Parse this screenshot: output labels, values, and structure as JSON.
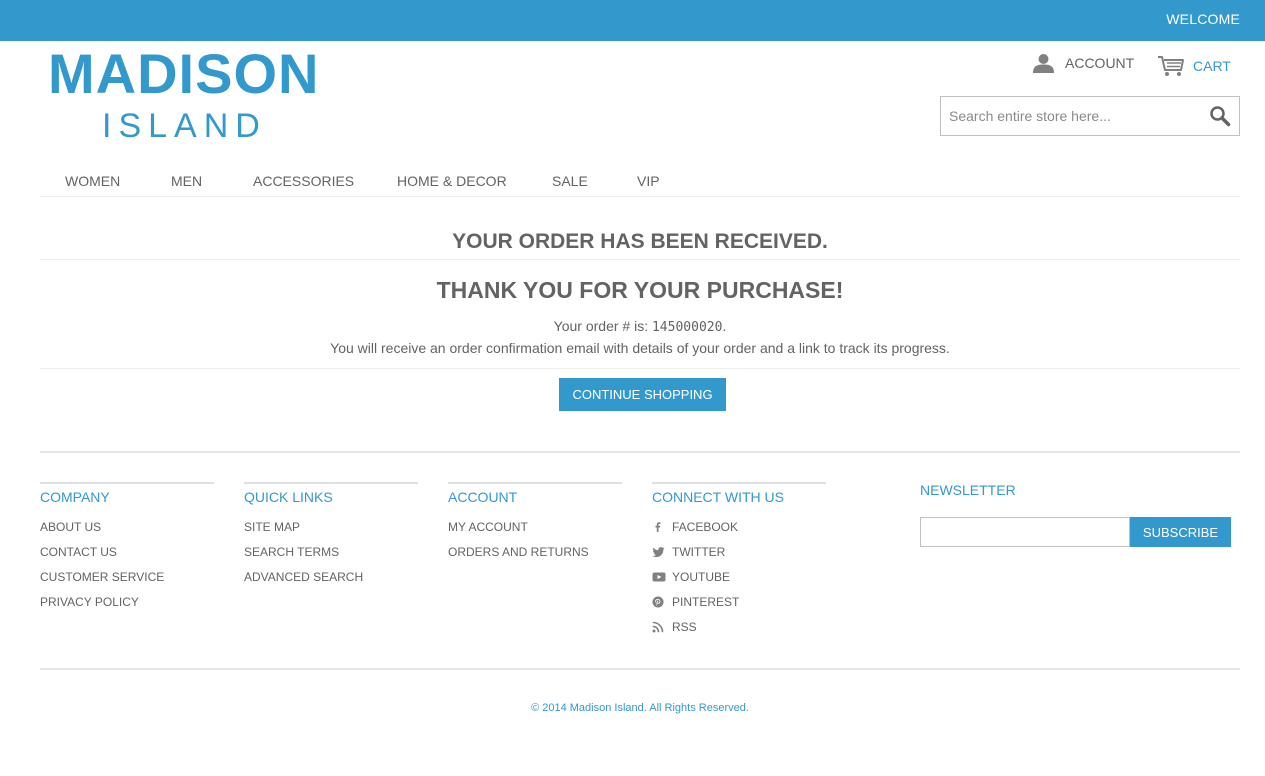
{
  "header": {
    "welcome": "WELCOME",
    "logo_line1": "MADISON",
    "logo_line2": "ISLAND",
    "account_label": "ACCOUNT",
    "cart_label": "CART",
    "search_placeholder": "Search entire store here..."
  },
  "nav": {
    "items": [
      "WOMEN",
      "MEN",
      "ACCESSORIES",
      "HOME & DECOR",
      "SALE",
      "VIP"
    ]
  },
  "main": {
    "title": "YOUR ORDER HAS BEEN RECEIVED.",
    "thank_you": "THANK YOU FOR YOUR PURCHASE!",
    "order_prefix": "Your order # is: ",
    "order_number": "145000020",
    "order_suffix": ".",
    "confirmation": "You will receive an order confirmation email with details of your order and a link to track its progress.",
    "continue_label": "CONTINUE SHOPPING"
  },
  "footer": {
    "company": {
      "title": "COMPANY",
      "items": [
        "ABOUT US",
        "CONTACT US",
        "CUSTOMER SERVICE",
        "PRIVACY POLICY"
      ]
    },
    "quick_links": {
      "title": "QUICK LINKS",
      "items": [
        "SITE MAP",
        "SEARCH TERMS",
        "ADVANCED SEARCH"
      ]
    },
    "account": {
      "title": "ACCOUNT",
      "items": [
        "MY ACCOUNT",
        "ORDERS AND RETURNS"
      ]
    },
    "connect": {
      "title": "CONNECT WITH US",
      "items": [
        "FACEBOOK",
        "TWITTER",
        "YOUTUBE",
        "PINTEREST",
        "RSS"
      ],
      "icons": [
        "facebook-icon",
        "twitter-icon",
        "youtube-icon",
        "pinterest-icon",
        "rss-icon"
      ]
    },
    "newsletter": {
      "title": "NEWSLETTER",
      "subscribe_label": "SUBSCRIBE",
      "email_value": ""
    },
    "copyright": "© 2014 Madison Island. All Rights Reserved."
  },
  "colors": {
    "accent": "#3399cc",
    "text": "#636363",
    "divider": "#ededed"
  }
}
